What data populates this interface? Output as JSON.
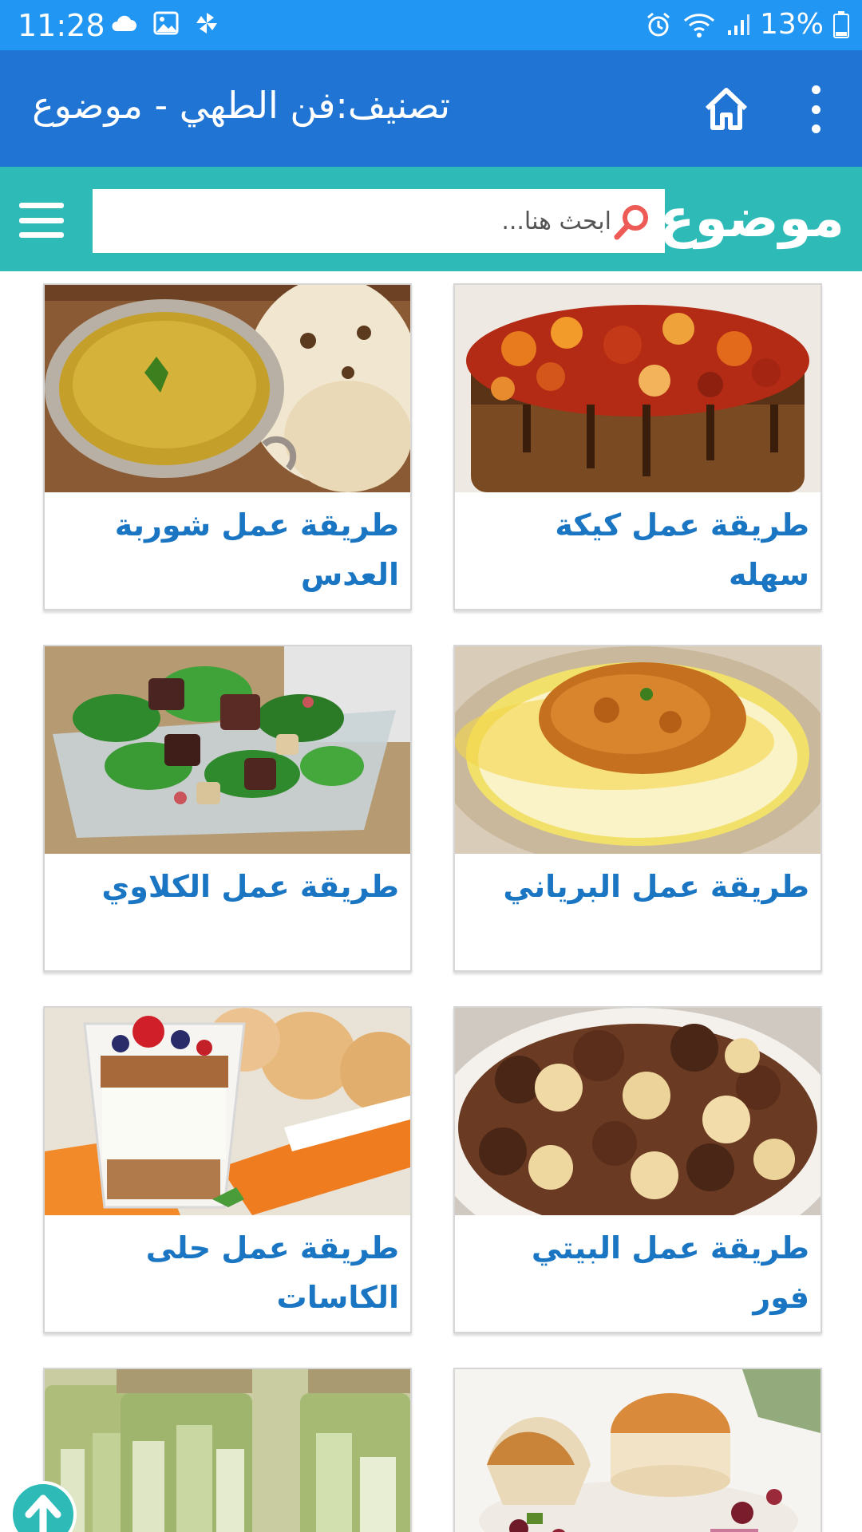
{
  "status_bar": {
    "time": "11:28",
    "battery": "13%",
    "left_icons": [
      "cloud-icon",
      "image-icon",
      "pinwheel-icon"
    ],
    "right_icons": [
      "alarm-icon",
      "wifi-icon",
      "signal-icon",
      "battery-icon"
    ]
  },
  "app_bar": {
    "title": "تصنيف:فن الطهي - موضوع",
    "color": "#1f74d4"
  },
  "site_header": {
    "logo": "موضوع",
    "search_placeholder": "ابحث هنا...",
    "color": "#2ebbb7"
  },
  "cards": [
    {
      "title": "طريقة عمل كيكة سهله",
      "image": "fruit-cake-photo"
    },
    {
      "title": "طريقة عمل شوربة العدس",
      "image": "lentil-soup-photo"
    },
    {
      "title": "طريقة عمل البرياني",
      "image": "biryani-photo"
    },
    {
      "title": "طريقة عمل الكلاوي",
      "image": "kidney-salad-photo"
    },
    {
      "title": "طريقة عمل البيتي فور",
      "image": "petit-four-photo"
    },
    {
      "title": "طريقة عمل حلى الكاسات",
      "image": "dessert-cups-photo"
    },
    {
      "title": "",
      "image": "seared-scallops-photo"
    },
    {
      "title": "",
      "image": "pickles-jars-photo"
    }
  ],
  "accent_colors": {
    "card_title": "#1a76c3",
    "status_bar": "#2196f3"
  }
}
